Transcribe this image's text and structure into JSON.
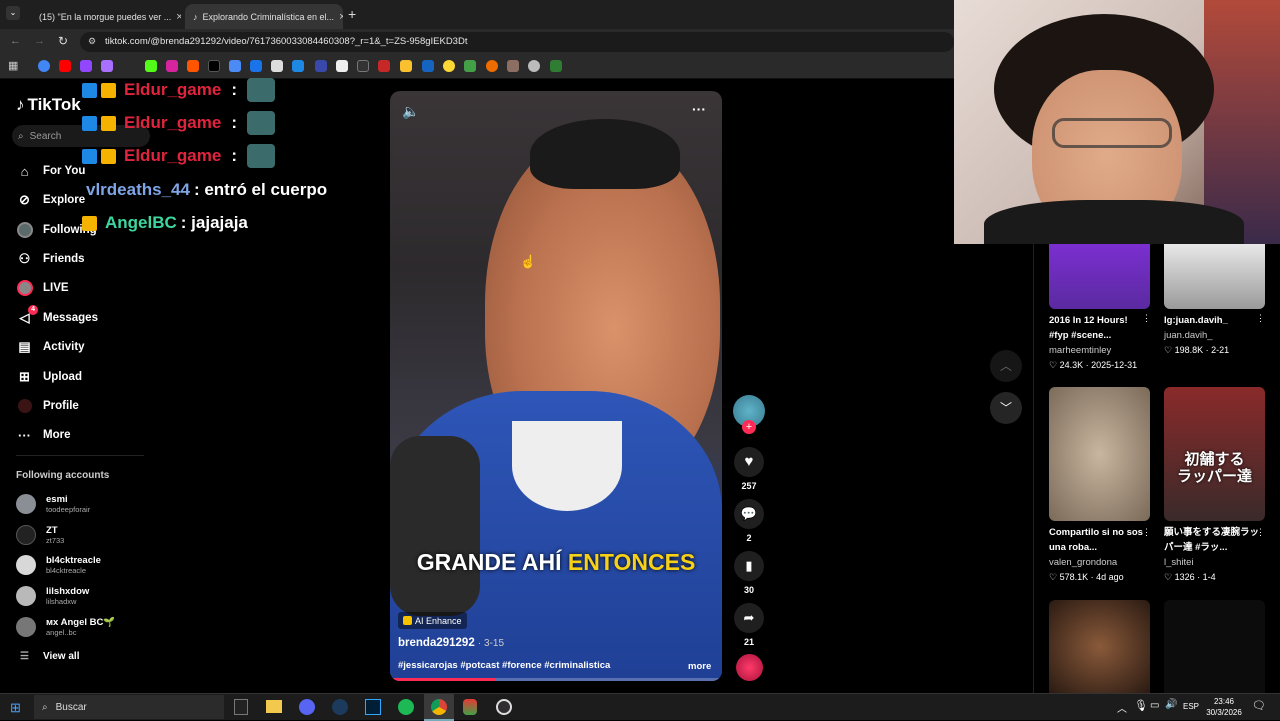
{
  "browser": {
    "tabs": [
      {
        "label": "(15) \"En la morgue puedes ver ..."
      },
      {
        "label": "Explorando Criminalística en el..."
      }
    ],
    "url": "tiktok.com/@brenda291292/video/7617360033084460308?_r=1&_t=ZS-958gIEKD3Dt"
  },
  "sidebar": {
    "logo": "TikTok",
    "search_placeholder": "Search",
    "nav": [
      {
        "label": "For You",
        "icon": "home-icon"
      },
      {
        "label": "Explore",
        "icon": "compass-icon"
      },
      {
        "label": "Following",
        "icon": "following-icon"
      },
      {
        "label": "Friends",
        "icon": "friends-icon"
      },
      {
        "label": "LIVE",
        "icon": "live-icon"
      },
      {
        "label": "Messages",
        "icon": "messages-icon",
        "badge": "4"
      },
      {
        "label": "Activity",
        "icon": "activity-icon"
      },
      {
        "label": "Upload",
        "icon": "upload-icon"
      },
      {
        "label": "Profile",
        "icon": "profile-icon"
      },
      {
        "label": "More",
        "icon": "more-icon"
      }
    ],
    "following_title": "Following accounts",
    "accounts": [
      {
        "name": "esmi",
        "handle": "toodeepforair"
      },
      {
        "name": "ZT",
        "handle": "zt733"
      },
      {
        "name": "bl4cktreacle",
        "handle": "bl4cktreacle"
      },
      {
        "name": "lilshxdow",
        "handle": "lilshadxw"
      },
      {
        "name": "ᴍx Angel BC🌱",
        "handle": "angel..bc"
      }
    ],
    "view_all": "View all"
  },
  "chat": [
    {
      "user": "Eldur_game",
      "text": ":",
      "color": "#e0243d"
    },
    {
      "user": "Eldur_game",
      "text": ":",
      "color": "#e0243d"
    },
    {
      "user": "Eldur_game",
      "text": ":",
      "color": "#e0243d"
    },
    {
      "user": "vlrdeaths_44",
      "text": ": entró el cuerpo",
      "color": "#7fa5e6"
    },
    {
      "user": "AngelBC",
      "text": ": jajajaja",
      "color": "#3ed6a0"
    }
  ],
  "video": {
    "caption": "GRANDE AHÍ",
    "caption_highlight": "ENTONCES",
    "ai_label": "AI Enhance",
    "author": "brenda291292",
    "date": "· 3-15",
    "hashtags": "#jessicarojas #potcast #forence #criminalistica",
    "more": "more",
    "likes": "257",
    "comments": "2",
    "saves": "30",
    "shares": "21"
  },
  "feed": [
    {
      "title": "2016 In 12 Hours! #fyp #scene...",
      "author": "marheemtinley",
      "stats": "♡ 24.3K · 2025-12-31"
    },
    {
      "title": "Ig:juan.davih_",
      "author": "juan.davih_",
      "stats": "♡ 198.8K · 2-21"
    },
    {
      "title": "Compartilo si no sos una roba...",
      "author": "valen_grondona",
      "stats": "♡ 578.1K · 4d ago"
    },
    {
      "title": "願い事をする凄腕ラッパー達 #ラッ...",
      "author": "l_shitei",
      "stats": "♡ 1326 · 1-4"
    },
    {
      "title": "",
      "author": "",
      "stats": ""
    },
    {
      "title": "",
      "author": "",
      "stats": ""
    }
  ],
  "feed_thumb_texts": {
    "rappers": "初舗する\nラッパー達"
  },
  "taskbar": {
    "search": "Buscar",
    "lang": "ESP",
    "time": "23:46",
    "date": "30/3/2026"
  }
}
